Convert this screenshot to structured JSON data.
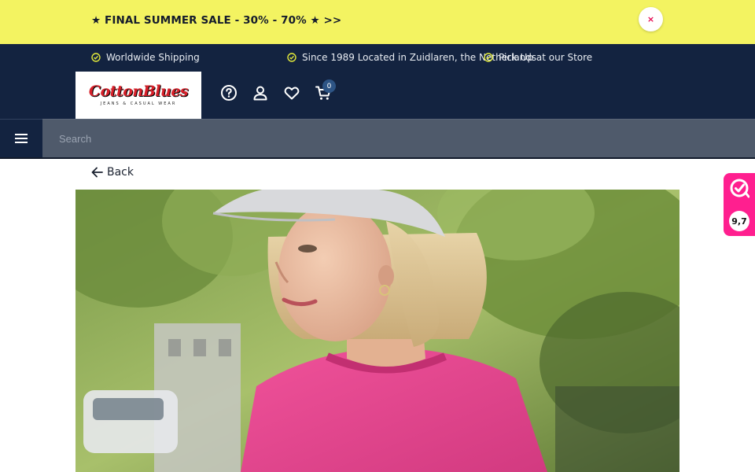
{
  "promo": {
    "text": "★ FINAL SUMMER SALE - 30% - 70% ★ >>",
    "close": "×"
  },
  "header": {
    "usps": [
      "Worldwide Shipping",
      "Since 1989 Located in Zuidlaren, the Netherlands",
      "Pick Up at our Store"
    ],
    "logo": {
      "main": "CottonBlues",
      "sub": "JEANS & CASUAL WEAR"
    },
    "cart_count": "0"
  },
  "search": {
    "placeholder": "Search"
  },
  "nav": {
    "back_label": "Back"
  },
  "rating": {
    "score": "9,7"
  },
  "icons": {
    "check": "check-circle-icon",
    "help": "help-circle-icon",
    "account": "user-icon",
    "wishlist": "heart-icon",
    "cart": "cart-icon",
    "menu": "hamburger-menu-icon",
    "back": "arrow-left-icon",
    "rating_logo": "kiyoh-logo-icon"
  },
  "colors": {
    "promo_bg": "#f3f361",
    "header_bg": "#132340",
    "search_bg": "#4f5a6b",
    "accent_check": "#e3ea3a",
    "rating_bg": "#ff1f8f",
    "logo_red": "#d7202a"
  }
}
